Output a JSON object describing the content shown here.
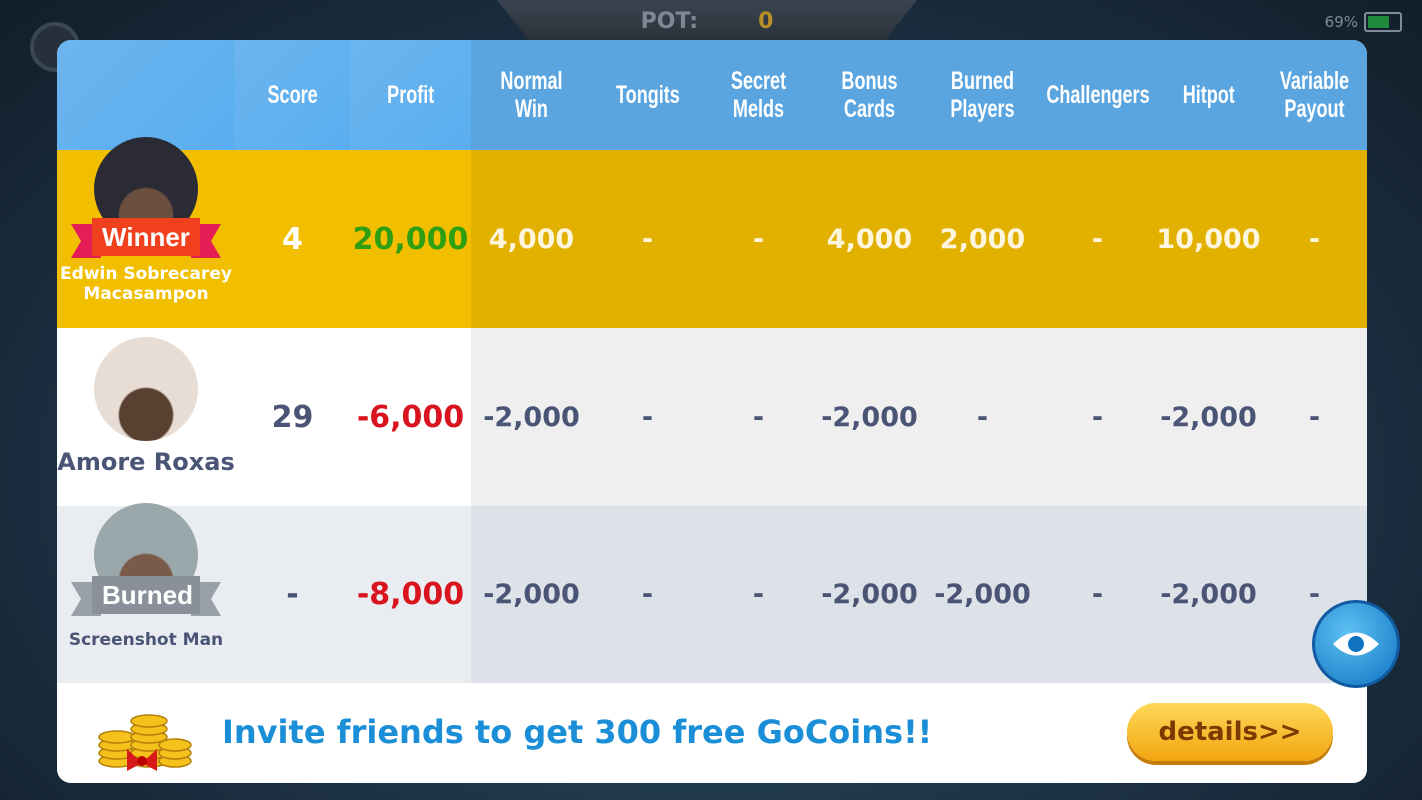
{
  "top": {
    "pot_label": "POT:",
    "pot_value": "0",
    "battery": "69%",
    "battery_level": 0.69
  },
  "headers": [
    "Score",
    "Profit",
    "Normal Win",
    "Tongits",
    "Secret Melds",
    "Bonus Cards",
    "Burned Players",
    "Challengers",
    "Hitpot",
    "Variable Payout"
  ],
  "rows": [
    {
      "name": "Edwin Sobrecarey Macasampon",
      "badge": "Winner",
      "score": "4",
      "profit": "20,000",
      "values": [
        "4,000",
        "-",
        "-",
        "4,000",
        "2,000",
        "-",
        "10,000",
        "-"
      ]
    },
    {
      "name": "Amore Roxas",
      "badge": "",
      "score": "29",
      "profit": "-6,000",
      "values": [
        "-2,000",
        "-",
        "-",
        "-2,000",
        "-",
        "-",
        "-2,000",
        "-"
      ]
    },
    {
      "name": "Screenshot Man",
      "badge": "Burned",
      "score": "-",
      "profit": "-8,000",
      "values": [
        "-2,000",
        "-",
        "-",
        "-2,000",
        "-2,000",
        "-",
        "-2,000",
        "-"
      ]
    }
  ],
  "footer": {
    "invite_text": "Invite friends to get 300 free GoCoins!!",
    "details_label": "details>>"
  },
  "colors": {
    "header": "#5aa5e0",
    "winner_row": "#f2bf00",
    "profit_positive": "#2e9e12",
    "profit_negative": "#d9141e",
    "invite": "#1a8fd8"
  }
}
